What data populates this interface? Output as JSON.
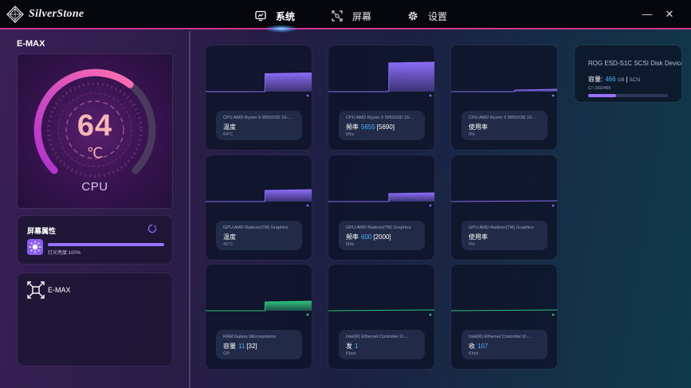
{
  "app": {
    "brand": "SilverStone",
    "nav": [
      {
        "label": "系统",
        "icon": "monitor-icon",
        "active": true
      },
      {
        "label": "屏幕",
        "icon": "screen-crop-icon",
        "active": false
      },
      {
        "label": "设置",
        "icon": "gear-icon",
        "active": false
      }
    ],
    "window_controls": {
      "minimize": "—",
      "close": "✕"
    },
    "accent_color": "#d0358f"
  },
  "left": {
    "device_title": "E-MAX",
    "gauge": {
      "value": "64",
      "unit": "℃",
      "label": "CPU",
      "fraction": 0.64
    },
    "screen_attr": {
      "title": "屏幕属性",
      "brightness_text": "灯光亮度:100%",
      "brightness_fraction": 1.0
    },
    "devices": [
      {
        "name": "E-MAX"
      }
    ]
  },
  "cards": [
    {
      "source": "CPU:AMD Ryzen 9 9950X3D 16-...",
      "metric": "温度",
      "value": "",
      "max": "",
      "unit": "64°C",
      "color": "#8a6cf5",
      "level": 0.45,
      "step_at": 0.56
    },
    {
      "source": "CPU:AMD Ryzen 9 9950X3D 16-...",
      "metric": "频率",
      "value": "5655",
      "max": "[5690]",
      "unit": "Mhz",
      "color": "#8a6cf5",
      "level": 0.72,
      "step_at": 0.57
    },
    {
      "source": "CPU:AMD Ryzen 9 9950X3D 16-...",
      "metric": "使用率",
      "value": "",
      "max": "",
      "unit": "9%",
      "color": "#8a6cf5",
      "level": 0.04,
      "step_at": 0.6
    },
    {
      "source": "GPU:AMD Radeon(TM) Graphics",
      "metric": "温度",
      "value": "",
      "max": "",
      "unit": "43°C",
      "color": "#8a6cf5",
      "level": 0.28,
      "step_at": 0.56
    },
    {
      "source": "GPU:AMD Radeon(TM) Graphics",
      "metric": "频率",
      "value": "600",
      "max": "[2000]",
      "unit": "Mhz",
      "color": "#8a6cf5",
      "level": 0.2,
      "step_at": 0.57
    },
    {
      "source": "GPU:AMD Radeon(TM) Graphics",
      "metric": "使用率",
      "value": "",
      "max": "",
      "unit": "0%",
      "color": "#8a6cf5",
      "level": 0.0,
      "step_at": 0.6
    },
    {
      "source": "RAM:Galaxy Microsystems",
      "metric": "容量",
      "value": "11",
      "max": "[32]",
      "unit": "GB",
      "color": "#2fc27a",
      "level": 0.22,
      "step_at": 0.56
    },
    {
      "source": "Intel(R) Ethernet Controller I2-...",
      "metric": "发",
      "value": "1",
      "max": "",
      "unit": "Kbps",
      "color": "#2fc27a",
      "level": 0.0,
      "step_at": 0.6
    },
    {
      "source": "Intel(R) Ethernet Controller I2-...",
      "metric": "收",
      "value": "107",
      "max": "",
      "unit": "Kbps",
      "color": "#2fc27a",
      "level": 0.0,
      "step_at": 0.6
    }
  ],
  "disk": {
    "name": "ROG ESD-S1C SCSI Disk Device",
    "capacity_label": "容量:",
    "capacity_value": "466",
    "capacity_unit": "GB",
    "type": "SCSI",
    "partition": "C:\\ 302/465",
    "used_fraction": 0.35
  }
}
